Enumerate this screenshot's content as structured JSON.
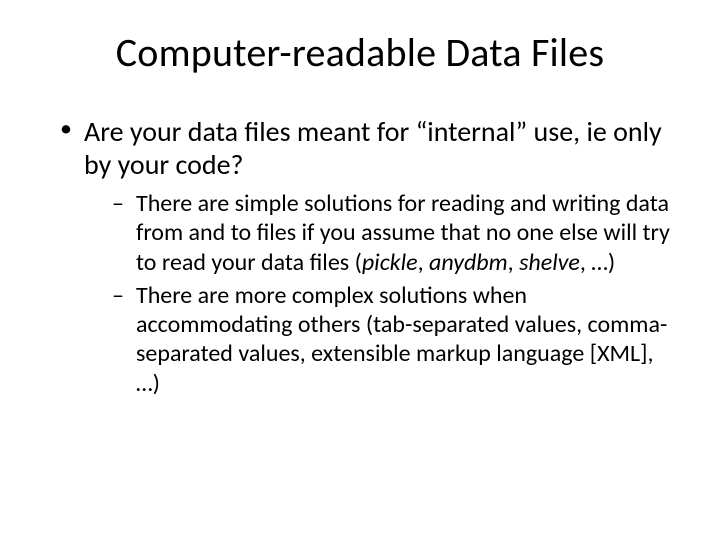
{
  "title": "Computer-readable Data Files",
  "bullet1_pre": "Are your data files meant for ",
  "bullet1_quote": "“internal”",
  "bullet1_post": " use, ie only by your code?",
  "sub1_pre": "There are simple solutions for reading and writing data from and to files if you assume that no one else will try to read your data files (",
  "sub1_it1": "pickle",
  "sub1_mid1": ", ",
  "sub1_it2": "anydbm",
  "sub1_mid2": ", ",
  "sub1_it3": "shelve",
  "sub1_post": ", …)",
  "sub2": "There are more complex solutions when accommodating others (tab-separated values, comma-separated values, extensible markup language [XML], …)"
}
